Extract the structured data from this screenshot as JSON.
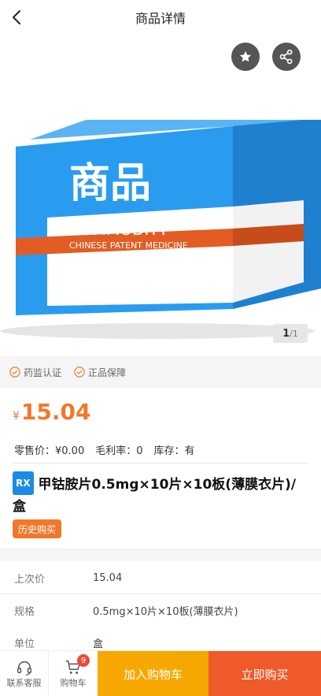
{
  "header": {
    "title": "商品详情"
  },
  "gallery": {
    "box_title": "商品",
    "box_subtitle": "COMMODITY",
    "box_stripe": "CHINESE PATENT MEDICINE",
    "current": "1",
    "total": "/1",
    "colors": {
      "box": "#2a9cf0",
      "stripe": "#e25c24"
    }
  },
  "certs": [
    {
      "label": "药监认证",
      "icon": "check-circle-icon"
    },
    {
      "label": "正品保障",
      "icon": "check-circle-icon"
    }
  ],
  "price": {
    "currency": "¥",
    "amount": "15.04"
  },
  "meta": {
    "retail": "零售价：¥0.00",
    "margin": "毛利率：0",
    "stock": "库存：有"
  },
  "product": {
    "badge": "RX",
    "name": "甲钴胺片0.5mg×10片×10板(薄膜衣片)/盒",
    "history_button": "历史购买"
  },
  "specs": [
    {
      "key": "上次价",
      "value": "15.04"
    },
    {
      "key": "规格",
      "value": "0.5mg×10片×10板(薄膜衣片)"
    },
    {
      "key": "单位",
      "value": "盒"
    }
  ],
  "bottom": {
    "service_label": "联系客服",
    "cart_label": "购物车",
    "cart_count": "9",
    "add_to_cart": "加入购物车",
    "buy_now": "立即购买"
  }
}
